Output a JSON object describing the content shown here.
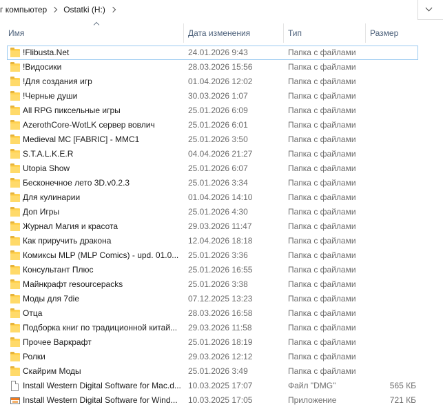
{
  "address": {
    "crumbs": [
      "г компьютер",
      "Ostatki (H:)"
    ]
  },
  "columns": {
    "name": "Имя",
    "date": "Дата изменения",
    "type": "Тип",
    "size": "Размер"
  },
  "files": [
    {
      "name": "!Flibusta.Net",
      "date": "24.01.2026 9:43",
      "type": "Папка с файлами",
      "size": "",
      "icon": "folder-icon"
    },
    {
      "name": "!Видосики",
      "date": "28.03.2026 15:56",
      "type": "Папка с файлами",
      "size": "",
      "icon": "folder-icon"
    },
    {
      "name": "!Для создания игр",
      "date": "01.04.2026 12:02",
      "type": "Папка с файлами",
      "size": "",
      "icon": "folder-icon"
    },
    {
      "name": "!Черные души",
      "date": "30.03.2026 1:07",
      "type": "Папка с файлами",
      "size": "",
      "icon": "folder-icon"
    },
    {
      "name": "All RPG пиксельные игры",
      "date": "25.01.2026 6:09",
      "type": "Папка с файлами",
      "size": "",
      "icon": "folder-icon"
    },
    {
      "name": "AzerothCore-WotLK сервер вовлич",
      "date": "25.01.2026 6:01",
      "type": "Папка с файлами",
      "size": "",
      "icon": "folder-icon"
    },
    {
      "name": "Medieval MC [FABRIC] - MMC1",
      "date": "25.01.2026 3:50",
      "type": "Папка с файлами",
      "size": "",
      "icon": "folder-icon"
    },
    {
      "name": "S.T.A.L.K.E.R",
      "date": "04.04.2026 21:27",
      "type": "Папка с файлами",
      "size": "",
      "icon": "folder-icon"
    },
    {
      "name": "Utopia Show",
      "date": "25.01.2026 6:07",
      "type": "Папка с файлами",
      "size": "",
      "icon": "folder-icon"
    },
    {
      "name": "Бесконечное лето 3D.v0.2.3",
      "date": "25.01.2026 3:34",
      "type": "Папка с файлами",
      "size": "",
      "icon": "folder-icon"
    },
    {
      "name": "Для кулинарии",
      "date": "01.04.2026 14:10",
      "type": "Папка с файлами",
      "size": "",
      "icon": "folder-icon"
    },
    {
      "name": "Доп Игры",
      "date": "25.01.2026 4:30",
      "type": "Папка с файлами",
      "size": "",
      "icon": "folder-icon"
    },
    {
      "name": "Журнал Магия и красота",
      "date": "29.03.2026 11:47",
      "type": "Папка с файлами",
      "size": "",
      "icon": "folder-icon"
    },
    {
      "name": "Как приручить дракона",
      "date": "12.04.2026 18:18",
      "type": "Папка с файлами",
      "size": "",
      "icon": "folder-icon"
    },
    {
      "name": "Комиксы MLP (MLP Comics) - upd. 01.0...",
      "date": "25.01.2026 3:36",
      "type": "Папка с файлами",
      "size": "",
      "icon": "folder-icon"
    },
    {
      "name": "Консультант Плюс",
      "date": "25.01.2026 16:55",
      "type": "Папка с файлами",
      "size": "",
      "icon": "folder-icon"
    },
    {
      "name": "Майнкрафт resourcepacks",
      "date": "25.01.2026 3:38",
      "type": "Папка с файлами",
      "size": "",
      "icon": "folder-icon"
    },
    {
      "name": "Моды для 7die",
      "date": "07.12.2025 13:23",
      "type": "Папка с файлами",
      "size": "",
      "icon": "folder-icon"
    },
    {
      "name": "Отца",
      "date": "28.03.2026 16:58",
      "type": "Папка с файлами",
      "size": "",
      "icon": "folder-icon"
    },
    {
      "name": "Подборка книг по традиционной китай...",
      "date": "29.03.2026 11:58",
      "type": "Папка с файлами",
      "size": "",
      "icon": "folder-icon"
    },
    {
      "name": "Прочее Варкрафт",
      "date": "25.01.2026 18:19",
      "type": "Папка с файлами",
      "size": "",
      "icon": "folder-icon"
    },
    {
      "name": "Ролки",
      "date": "29.03.2026 12:12",
      "type": "Папка с файлами",
      "size": "",
      "icon": "folder-icon"
    },
    {
      "name": "Скайрим Моды",
      "date": "25.01.2026 3:49",
      "type": "Папка с файлами",
      "size": "",
      "icon": "folder-icon"
    },
    {
      "name": "Install Western Digital Software for Mac.d...",
      "date": "10.03.2025 17:07",
      "type": "Файл \"DMG\"",
      "size": "565 КБ",
      "icon": "document-icon"
    },
    {
      "name": "Install Western Digital Software for Wind...",
      "date": "10.03.2025 17:05",
      "type": "Приложение",
      "size": "721 КБ",
      "icon": "application-icon"
    }
  ]
}
